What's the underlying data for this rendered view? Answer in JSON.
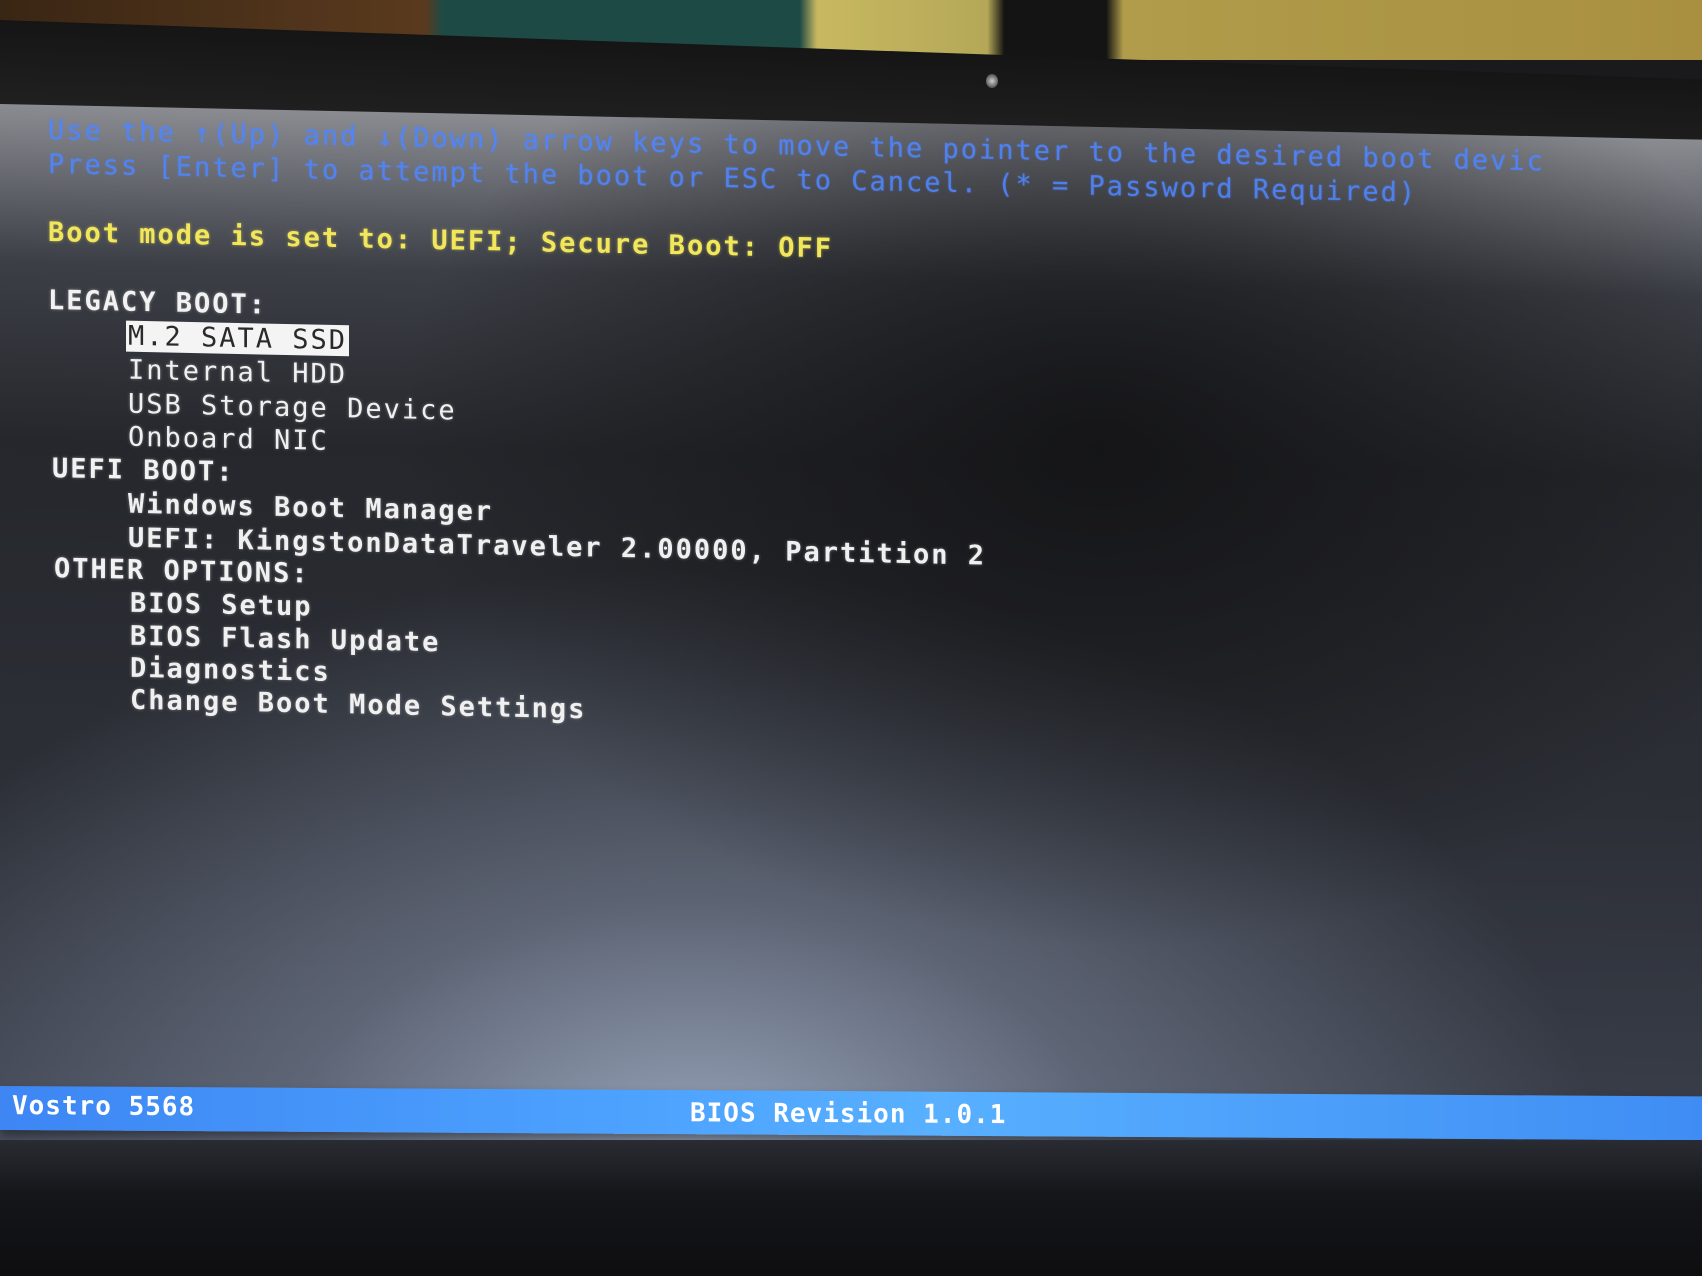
{
  "help": {
    "line1": "Use the ↑(Up) and ↓(Down) arrow keys to move the pointer to the desired boot devic",
    "line2": "Press [Enter] to attempt the boot or ESC to Cancel. (* = Password Required)"
  },
  "boot_mode": "Boot mode is set to: UEFI; Secure Boot: OFF",
  "sections": {
    "legacy": {
      "title": "LEGACY BOOT:",
      "items": [
        "M.2 SATA SSD",
        "Internal HDD",
        "USB Storage Device",
        "Onboard NIC"
      ],
      "selected_index": 0
    },
    "uefi": {
      "title": "UEFI BOOT:",
      "items": [
        "Windows Boot Manager",
        "UEFI: KingstonDataTraveler 2.00000, Partition 2"
      ]
    },
    "other": {
      "title": "OTHER OPTIONS:",
      "items": [
        "BIOS Setup",
        "BIOS Flash Update",
        "Diagnostics",
        "Change Boot Mode Settings"
      ]
    }
  },
  "statusbar": {
    "model": "Vostro 5568",
    "bios_revision": "BIOS Revision 1.0.1"
  },
  "colors": {
    "help_text": "#4f86ff",
    "mode_text": "#f2e65a",
    "menu_text": "#f0f0f0",
    "statusbar": "#4ea4ff",
    "selection_bg": "#f4f4f4"
  }
}
